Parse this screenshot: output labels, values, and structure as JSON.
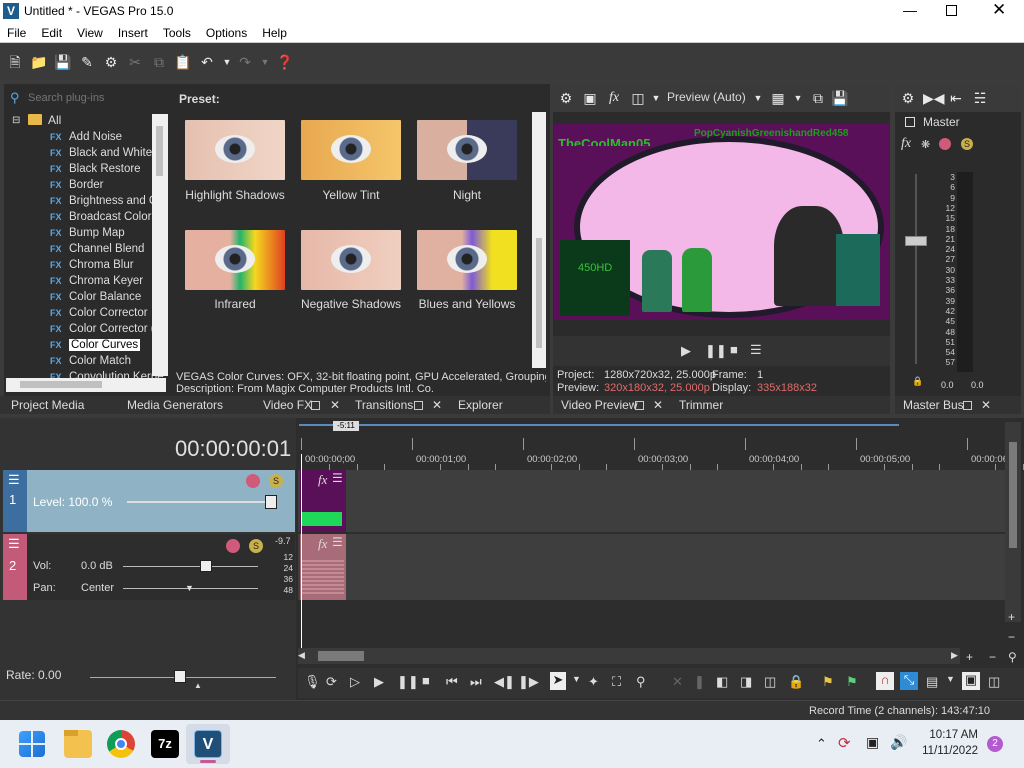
{
  "window": {
    "title": "Untitled * - VEGAS Pro 15.0",
    "app_icon": "V"
  },
  "menu": [
    "File",
    "Edit",
    "View",
    "Insert",
    "Tools",
    "Options",
    "Help"
  ],
  "plugins": {
    "search_placeholder": "Search plug-ins",
    "root": "All",
    "items": [
      "Add Noise",
      "Black and White",
      "Black Restore",
      "Border",
      "Brightness and Co",
      "Broadcast Colors",
      "Bump Map",
      "Channel Blend",
      "Chroma Blur",
      "Chroma Keyer",
      "Color Balance",
      "Color Corrector",
      "Color Corrector (S",
      "Color Curves",
      "Color Match",
      "Convolution Kerne"
    ],
    "selected": "Color Curves",
    "fx_badge": "FX"
  },
  "preset": {
    "label": "Preset:",
    "items": [
      "Highlight Shadows",
      "Yellow Tint",
      "Night",
      "Infrared",
      "Negative Shadows",
      "Blues and Yellows"
    ]
  },
  "fx_info": {
    "line1": "VEGAS Color Curves: OFX, 32-bit floating point, GPU Accelerated, Grouping V",
    "line2": "Description: From Magix Computer Products Intl. Co."
  },
  "left_tabs": [
    "Project Media",
    "Media Generators",
    "Video FX",
    "Transitions",
    "Explorer"
  ],
  "preview": {
    "mode": "Preview (Auto)",
    "overlay_text": "TheCoolMan05",
    "overlay_text2": "PopCyanishGreenishandRed458",
    "video_text": "450HD",
    "project_label": "Project:",
    "project": "1280x720x32, 25.000p",
    "frame_label": "Frame:",
    "frame": "1",
    "preview_label": "Preview:",
    "preview": "320x180x32, 25.000p",
    "display_label": "Display:",
    "display": "335x188x32"
  },
  "preview_tabs": [
    "Video Preview",
    "Trimmer"
  ],
  "master": {
    "label": "Master",
    "tab": "Master Bus",
    "scale": [
      "3",
      "6",
      "9",
      "12",
      "15",
      "18",
      "21",
      "24",
      "27",
      "30",
      "33",
      "36",
      "39",
      "42",
      "45",
      "48",
      "51",
      "54",
      "57"
    ],
    "left_val": "0.0",
    "right_val": "0.0"
  },
  "timeline": {
    "timecode": "00:00:00:01",
    "ruler": [
      "00:00:00;00",
      "00:00:01;00",
      "00:00:02;00",
      "00:00:03;00",
      "00:00:04;00",
      "00:00:05;00",
      "00:00:06;"
    ],
    "marker": "-5:11",
    "video_track": {
      "num": "1",
      "level": "Level: 100.0 %"
    },
    "audio_track": {
      "num": "2",
      "vol_label": "Vol:",
      "vol": "0.0 dB",
      "pan_label": "Pan:",
      "pan": "Center",
      "db_peak": "-9.7",
      "db_scale": [
        "12",
        "24",
        "36",
        "48"
      ]
    }
  },
  "rate": "Rate: 0.00",
  "status": "Record Time (2 channels): 143:47:10",
  "taskbar": {
    "time": "10:17 AM",
    "date": "11/11/2022",
    "badge": "2",
    "apps": [
      "start",
      "explorer",
      "chrome",
      "7zip",
      "vegas"
    ]
  },
  "colors": {
    "accent": "#2e8bd6",
    "video_track": "#8fb3c4",
    "audio_track": "#c45a79"
  }
}
